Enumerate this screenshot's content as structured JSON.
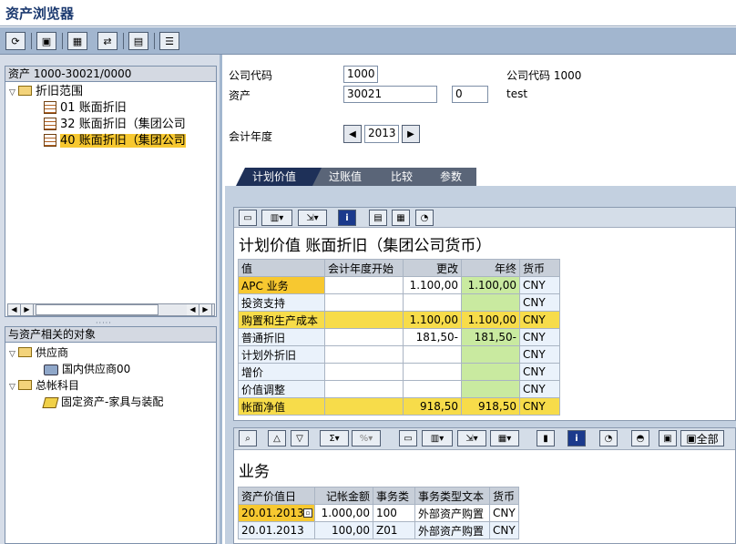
{
  "window": {
    "title": "资产浏览器"
  },
  "colors": {
    "toolbar": "#a2b6cf",
    "selection": "#f7c830",
    "tab_active": "#1e3058",
    "yellow_cell": "#f7dc4a",
    "green_cell": "#c9eaa0"
  },
  "left": {
    "tree_header": "资产 1000-30021/0000",
    "tree": {
      "root": "折旧范围",
      "items": [
        {
          "code": "01",
          "label": "账面折旧"
        },
        {
          "code": "32",
          "label": "账面折旧（集团公司"
        },
        {
          "code": "40",
          "label": "账面折旧（集团公司"
        }
      ]
    },
    "related_header": "与资产相关的对象",
    "related": {
      "vendor_folder": "供应商",
      "vendor_item": "国内供应商00",
      "gl_folder": "总帐科目",
      "gl_item": "固定资产-家具与装配"
    }
  },
  "header": {
    "company_code_label": "公司代码",
    "company_code_value": "1000",
    "company_code_text": "公司代码 1000",
    "asset_label": "资产",
    "asset_value": "30021",
    "sub_value": "0",
    "asset_text": "test",
    "fiscal_year_label": "会计年度",
    "fiscal_year_value": "2013"
  },
  "tabs": [
    "计划价值",
    "过账值",
    "比较",
    "参数"
  ],
  "plan_grid": {
    "title": "计划价值 账面折旧（集团公司货币）",
    "columns": [
      "值",
      "会计年度开始",
      "更改",
      "年终",
      "货币"
    ],
    "rows": [
      {
        "name": "APC 业务",
        "start": "",
        "change": "1.100,00",
        "end": "1.100,00",
        "cur": "CNY"
      },
      {
        "name": "投资支持",
        "start": "",
        "change": "",
        "end": "",
        "cur": "CNY"
      },
      {
        "name": "购置和生产成本",
        "start": "",
        "change": "1.100,00",
        "end": "1.100,00",
        "cur": "CNY"
      },
      {
        "name": "普通折旧",
        "start": "",
        "change": "181,50-",
        "end": "181,50-",
        "cur": "CNY"
      },
      {
        "name": "计划外折旧",
        "start": "",
        "change": "",
        "end": "",
        "cur": "CNY"
      },
      {
        "name": "增价",
        "start": "",
        "change": "",
        "end": "",
        "cur": "CNY"
      },
      {
        "name": "价值调整",
        "start": "",
        "change": "",
        "end": "",
        "cur": "CNY"
      },
      {
        "name": "帐面净值",
        "start": "",
        "change": "918,50",
        "end": "918,50",
        "cur": "CNY"
      }
    ]
  },
  "trans_grid": {
    "title": "业务",
    "all_button": "全部",
    "columns": [
      "资产价值日",
      "记帐金额",
      "事务类",
      "事务类型文本",
      "货币"
    ],
    "rows": [
      {
        "date": "20.01.2013",
        "amount": "1.000,00",
        "type": "100",
        "text": "外部资产购置",
        "cur": "CNY"
      },
      {
        "date": "20.01.2013",
        "amount": "100,00",
        "type": "Z01",
        "text": "外部资产购置",
        "cur": "CNY"
      }
    ]
  }
}
